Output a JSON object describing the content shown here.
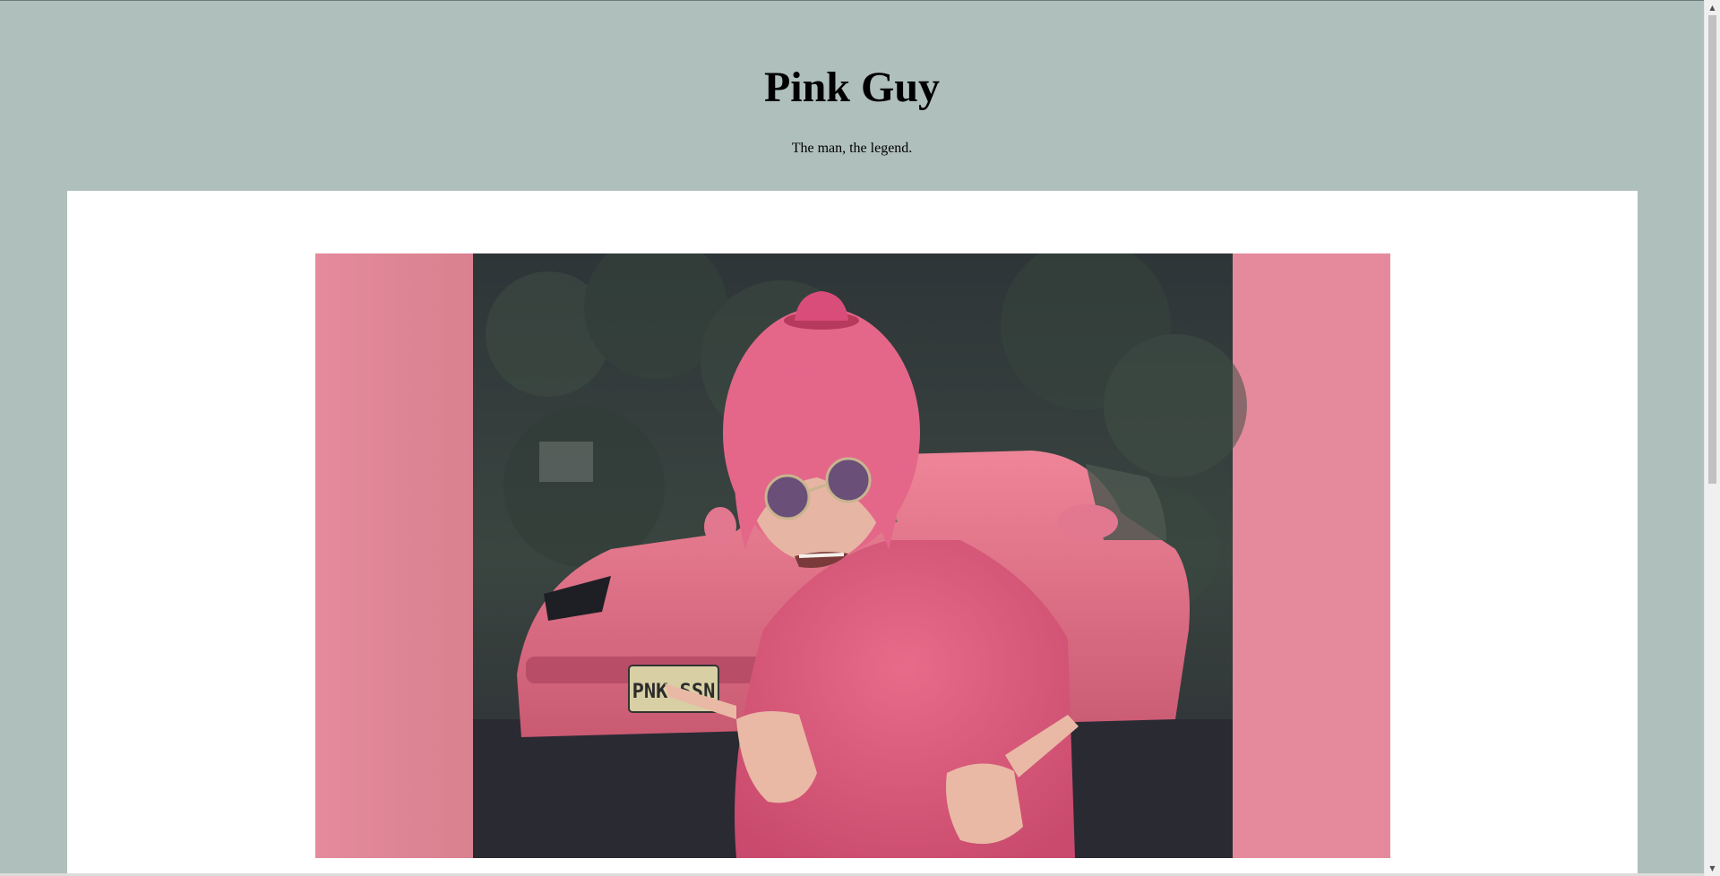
{
  "page": {
    "title": "Pink Guy",
    "subtitle": "The man, the legend."
  },
  "image": {
    "license_plate": "PNK·SSN"
  },
  "colors": {
    "page_background": "#afbfbc",
    "content_background": "#ffffff",
    "image_border_pink": "#e38a9b"
  },
  "scrollbar": {
    "up_icon": "chevron-up-icon",
    "down_icon": "chevron-down-icon"
  }
}
